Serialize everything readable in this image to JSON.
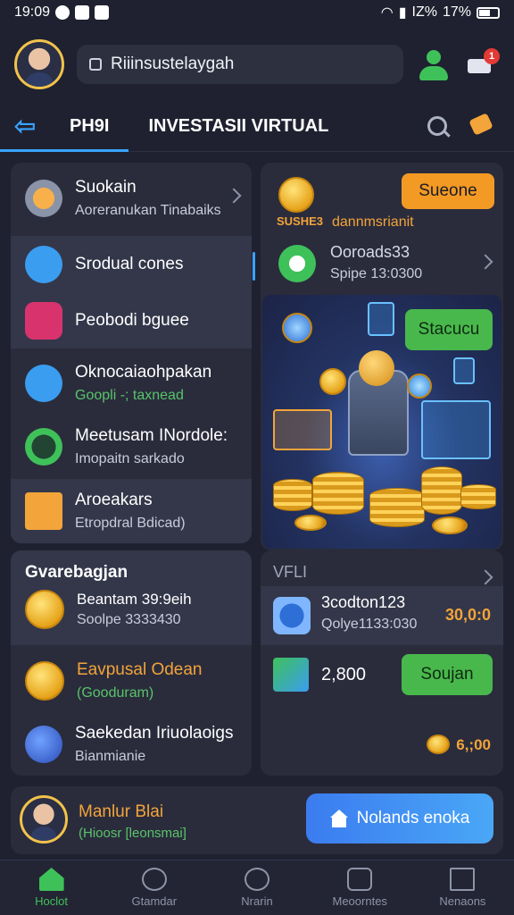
{
  "status_bar": {
    "time": "19:09",
    "battery": "17%",
    "signal": "IZ%"
  },
  "header": {
    "search_text": "Riiinsustelaygah",
    "cart_badge": "1"
  },
  "tabs": {
    "first": "PH9I",
    "second": "INVESTASII VIRTUAL"
  },
  "left_menu": [
    {
      "title": "Suokain",
      "subtitle": "Aoreranukan Tinabaiks",
      "icon_color": "#f07a2a"
    },
    {
      "title": "Srodual cones",
      "subtitle": "",
      "icon_color": "#3a9df0"
    },
    {
      "title": "Peobodi bguee",
      "subtitle": "",
      "icon_color": "#d9336e"
    },
    {
      "title": "Oknocaiaohpakan",
      "subtitle": "Goopli -; taxnead",
      "icon_color": "#3a9df0"
    },
    {
      "title": "Meetusam INordole:",
      "subtitle": "Imopaitn sarkado",
      "icon_color": "#3fc15a"
    },
    {
      "title": "Aroeakars",
      "subtitle": "Etropdral Bdicad)",
      "icon_color": "#f3a43a"
    }
  ],
  "right_top": {
    "coin_label": "SUSHE3",
    "desc": "dannmsrianit",
    "orange_button": "Sueone",
    "item_title": "Ooroads33",
    "item_sub": "Spipe 13:0300",
    "green_button": "Stacucu"
  },
  "left_bottom": {
    "header": "Gvarebagjan",
    "items": [
      {
        "title": "Beantam 39:9eih",
        "subtitle": "Soolpe 3333430"
      },
      {
        "title": "Eavpusal Odean",
        "subtitle": "(Gooduram)"
      },
      {
        "title": "Saekedan Iriuolaoigs",
        "subtitle": "Bianmianie"
      }
    ]
  },
  "right_bottom": {
    "header": "VFLI",
    "row_title": "3codton123",
    "row_sub": "Qolye1133:030",
    "row_value": "30,0:0",
    "amount": "2,800",
    "green_button": "Soujan",
    "footer_value": "6,;00"
  },
  "profile": {
    "name": "Manlur Blai",
    "subtitle": "(Hioosr [leonsmai]",
    "button": "Nolands enoka"
  },
  "bottom_nav": [
    "Hoclot",
    "Gtamdar",
    "Nrarin",
    "Meoorntes",
    "Nenaons"
  ]
}
